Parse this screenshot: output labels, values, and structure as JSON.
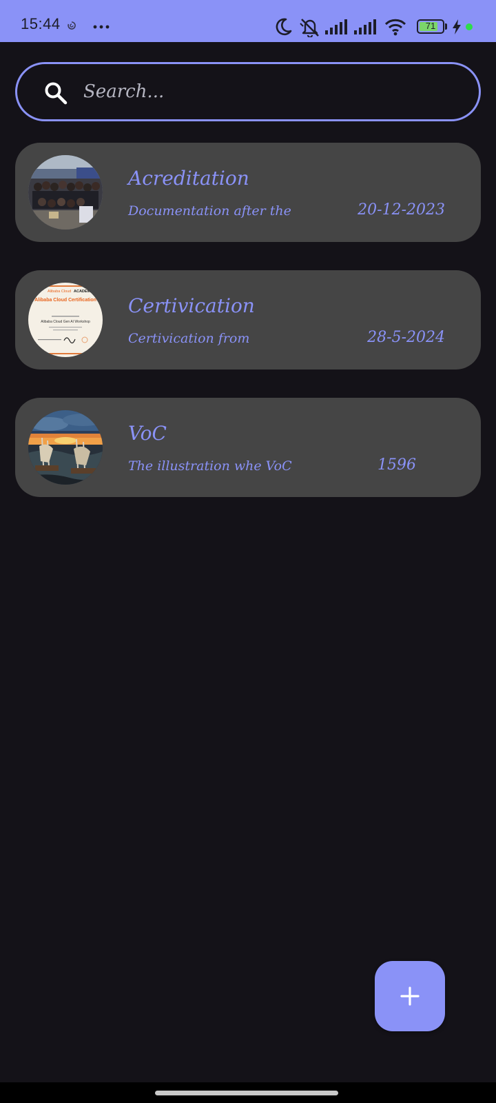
{
  "status_bar": {
    "time": "15:44",
    "battery_level": "71",
    "icons": [
      "sync-icon",
      "more-icon",
      "moon-icon",
      "bell-off-icon",
      "signal-icon",
      "signal-icon",
      "wifi-icon",
      "battery-icon",
      "charging-icon"
    ],
    "colors": {
      "background": "#8A92F7",
      "battery_fill": "#7BD66A",
      "dot": "#2EDD4A"
    }
  },
  "search": {
    "placeholder": "Search..."
  },
  "notes": [
    {
      "title": "Acreditation",
      "description": "Documentation after the",
      "date": "20-12-2023"
    },
    {
      "title": "Certivication",
      "description": "Certivication from",
      "date": "28-5-2024"
    },
    {
      "title": "VoC",
      "description": "The illustration whe VoC",
      "date": "1596"
    }
  ],
  "certificate_thumb": {
    "brand": "Alibaba Cloud",
    "academy": "ACADEMY",
    "heading": "Alibaba Cloud Certification",
    "course": "Alibaba Cloud Gen AI Workshop"
  },
  "fab": {
    "icon": "plus-icon"
  },
  "colors": {
    "accent": "#8A92F7",
    "background": "#141218",
    "card": "#454545",
    "placeholder": "#B6B6C2"
  }
}
